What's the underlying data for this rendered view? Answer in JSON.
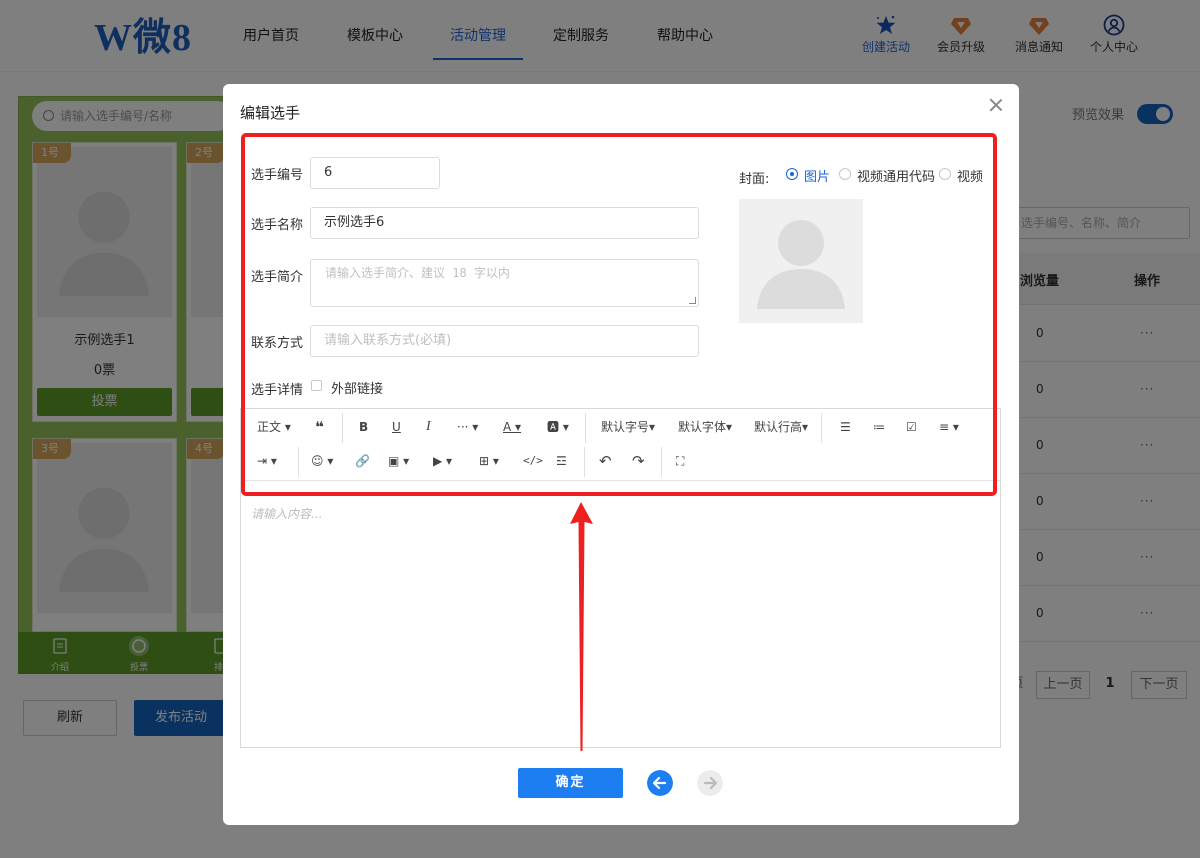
{
  "header": {
    "logo": "W微8",
    "nav": [
      "用户首页",
      "模板中心",
      "活动管理",
      "定制服务",
      "帮助中心"
    ],
    "active_nav": "活动管理",
    "tools": [
      {
        "label": "创建活动",
        "icon": "star-icon"
      },
      {
        "label": "会员升级",
        "icon": "diamond-icon"
      },
      {
        "label": "消息通知",
        "icon": "bell-badge-icon"
      },
      {
        "label": "个人中心",
        "icon": "user-icon"
      }
    ]
  },
  "preview_phone": {
    "search_placeholder": "请输入选手编号/名称",
    "cards": [
      {
        "no": "1号",
        "name": "示例选手1",
        "votes": "0票",
        "vote_btn": "投票"
      },
      {
        "no": "2号"
      },
      {
        "no": "3号"
      },
      {
        "no": "4号"
      }
    ],
    "bottom_tabs": [
      "介绍",
      "投票",
      "排"
    ]
  },
  "page_actions": {
    "refresh": "刷新",
    "publish": "发布活动"
  },
  "right_panel": {
    "preview_label": "预览效果",
    "search_placeholder": "选手编号、名称、简介",
    "columns": [
      "浏览量",
      "操作"
    ],
    "rows": [
      {
        "views": "0",
        "op": "···"
      },
      {
        "views": "0",
        "op": "···"
      },
      {
        "views": "0",
        "op": "···"
      },
      {
        "views": "0",
        "op": "···"
      },
      {
        "views": "0",
        "op": "···"
      },
      {
        "views": "0",
        "op": "···"
      }
    ],
    "pagination": {
      "prev_fragment": "页",
      "prev": "上一页",
      "current": "1",
      "next": "下一页"
    }
  },
  "modal": {
    "title": "编辑选手",
    "fields": {
      "number": {
        "label": "选手编号",
        "value": "6"
      },
      "name": {
        "label": "选手名称",
        "value": "示例选手6"
      },
      "intro": {
        "label": "选手简介",
        "placeholder": "请输入选手简介、建议 18 字以内"
      },
      "contact": {
        "label": "联系方式",
        "placeholder": "请输入联系方式(必填)"
      },
      "detail": {
        "label": "选手详情",
        "external_link": "外部链接"
      }
    },
    "cover": {
      "label": "封面:",
      "options": [
        "图片",
        "视频通用代码",
        "视频"
      ],
      "selected": "图片"
    },
    "editor": {
      "toolbar_row1": [
        "正文",
        "默认字号",
        "默认字体",
        "默认行高"
      ],
      "placeholder": "请输入内容..."
    },
    "confirm": "确定"
  },
  "colors": {
    "accent": "#1c64d8",
    "annotation": "#ee1f1f",
    "phone_green": "#97c35a"
  }
}
